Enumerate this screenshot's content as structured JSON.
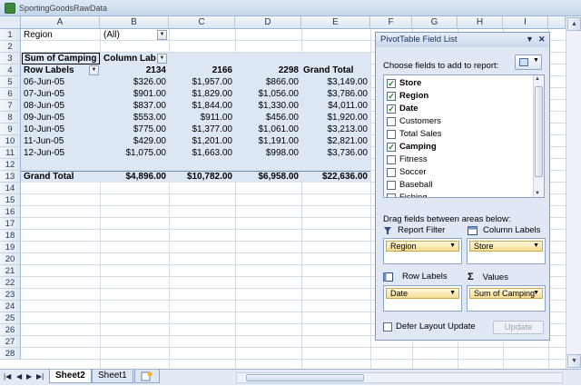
{
  "window": {
    "title": "SportingGoodsRawData"
  },
  "columns": [
    "A",
    "B",
    "C",
    "D",
    "E",
    "F",
    "G",
    "H",
    "I"
  ],
  "rows": [
    "1",
    "2",
    "3",
    "4",
    "5",
    "6",
    "7",
    "8",
    "9",
    "10",
    "11",
    "12",
    "13",
    "14",
    "15",
    "16",
    "17",
    "18",
    "19",
    "20",
    "21",
    "22",
    "23",
    "24",
    "25",
    "26",
    "27",
    "28"
  ],
  "pivot": {
    "filter_label": "Region",
    "filter_value": "(All)",
    "value_field": "Sum of Camping",
    "column_labels": "Column Lab",
    "row_labels": "Row Labels",
    "col_headers": [
      "2134",
      "2166",
      "2298",
      "Grand Total"
    ],
    "data_rows": [
      {
        "label": "06-Jun-05",
        "v": [
          "$326.00",
          "$1,957.00",
          "$866.00",
          "$3,149.00"
        ]
      },
      {
        "label": "07-Jun-05",
        "v": [
          "$901.00",
          "$1,829.00",
          "$1,056.00",
          "$3,786.00"
        ]
      },
      {
        "label": "08-Jun-05",
        "v": [
          "$837.00",
          "$1,844.00",
          "$1,330.00",
          "$4,011.00"
        ]
      },
      {
        "label": "09-Jun-05",
        "v": [
          "$553.00",
          "$911.00",
          "$456.00",
          "$1,920.00"
        ]
      },
      {
        "label": "10-Jun-05",
        "v": [
          "$775.00",
          "$1,377.00",
          "$1,061.00",
          "$3,213.00"
        ]
      },
      {
        "label": "11-Jun-05",
        "v": [
          "$429.00",
          "$1,201.00",
          "$1,191.00",
          "$2,821.00"
        ]
      },
      {
        "label": "12-Jun-05",
        "v": [
          "$1,075.00",
          "$1,663.00",
          "$998.00",
          "$3,736.00"
        ]
      }
    ],
    "grand_total_label": "Grand Total",
    "grand_total": [
      "$4,896.00",
      "$10,782.00",
      "$6,958.00",
      "$22,636.00"
    ]
  },
  "field_panel": {
    "title": "PivotTable Field List",
    "choose_label": "Choose fields to add to report:",
    "fields": [
      {
        "name": "Store",
        "checked": true
      },
      {
        "name": "Region",
        "checked": true
      },
      {
        "name": "Date",
        "checked": true
      },
      {
        "name": "Customers",
        "checked": false
      },
      {
        "name": "Total Sales",
        "checked": false
      },
      {
        "name": "Camping",
        "checked": true
      },
      {
        "name": "Fitness",
        "checked": false
      },
      {
        "name": "Soccer",
        "checked": false
      },
      {
        "name": "Baseball",
        "checked": false
      },
      {
        "name": "Fishing",
        "checked": false
      }
    ],
    "drag_label": "Drag fields between areas below:",
    "report_filter_label": "Report Filter",
    "column_labels_label": "Column Labels",
    "row_labels_label": "Row Labels",
    "values_label": "Values",
    "report_filter_chip": "Region",
    "column_labels_chip": "Store",
    "row_labels_chip": "Date",
    "values_chip": "Sum of Camping",
    "defer_label": "Defer Layout Update",
    "update_label": "Update"
  },
  "sheets": {
    "tabs": [
      "Sheet2",
      "Sheet1"
    ],
    "active": "Sheet2"
  }
}
